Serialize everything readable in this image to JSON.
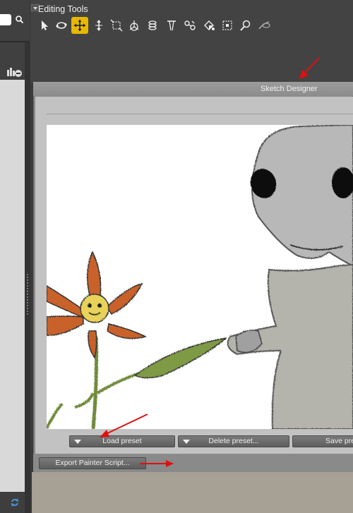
{
  "editing_tools": {
    "title": "Editing Tools",
    "tools": [
      {
        "name": "select-icon",
        "active": false
      },
      {
        "name": "rotate-icon",
        "active": false
      },
      {
        "name": "translate-icon",
        "active": true
      },
      {
        "name": "scale-vertical-icon",
        "active": false
      },
      {
        "name": "scale-icon",
        "active": false
      },
      {
        "name": "universal-icon",
        "active": false
      },
      {
        "name": "twist-icon",
        "active": false
      },
      {
        "name": "taper-icon",
        "active": false
      },
      {
        "name": "chain-icon",
        "active": false
      },
      {
        "name": "color-icon",
        "active": false
      },
      {
        "name": "grab-icon",
        "active": false
      },
      {
        "name": "zoom-icon",
        "active": false
      },
      {
        "name": "morph-brush-icon",
        "active": false
      }
    ],
    "accent_color": "#e6b800"
  },
  "sketch_designer": {
    "title": "Sketch Designer",
    "load_preset_label": "Load preset",
    "delete_preset_label": "Delete preset...",
    "save_preset_label": "Save preset",
    "export_script_label": "Export Painter Script..."
  },
  "annotation_arrow_color": "#dd1111"
}
